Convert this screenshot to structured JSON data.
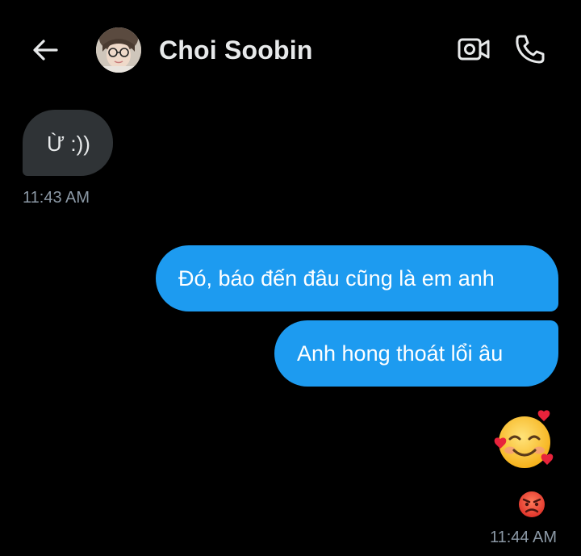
{
  "header": {
    "contact_name": "Choi Soobin"
  },
  "messages": [
    {
      "direction": "incoming",
      "text": "Ừ :))",
      "time": "11:43 AM"
    },
    {
      "direction": "outgoing",
      "text": "Đó, báo đến đâu cũng là em anh"
    },
    {
      "direction": "outgoing",
      "text": "Anh hong thoát lổi âu"
    },
    {
      "direction": "outgoing",
      "emoji": "smiling-face-with-hearts",
      "reaction": "angry-face",
      "time": "11:44 AM"
    }
  ],
  "colors": {
    "background": "#000000",
    "incoming_bubble": "#2f3336",
    "outgoing_bubble": "#1d9bf0",
    "timestamp": "#8b98a5"
  }
}
